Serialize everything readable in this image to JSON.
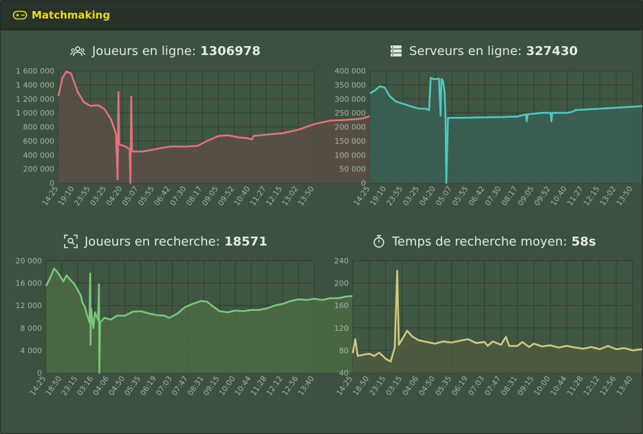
{
  "header": {
    "title": "Matchmaking",
    "icon": "gamepad-icon",
    "title_color": "#f0d81c"
  },
  "chart_data": [
    {
      "type": "area",
      "title": "Joueurs en ligne: 1306978",
      "title_label": "Joueurs en ligne:",
      "title_value": "1306978",
      "icon": "users-icon",
      "color": "#e8707e",
      "fill": "#5a4d47",
      "ylim": [
        0,
        1600000
      ],
      "yticks": [
        "0",
        "200 000",
        "400 000",
        "600 000",
        "800 000",
        "1 000 000",
        "1 200 000",
        "1 400 000",
        "1 600 000"
      ],
      "xticks": [
        "14:25",
        "19:10",
        "23:55",
        "03:25",
        "04:20",
        "05:07",
        "05:55",
        "06:42",
        "07:30",
        "08:17",
        "09:05",
        "09:52",
        "10:40",
        "11:27",
        "12:15",
        "13:02",
        "13:50"
      ],
      "grid": true,
      "points": [
        [
          0,
          1240000
        ],
        [
          0.25,
          1500000
        ],
        [
          0.5,
          1590000
        ],
        [
          0.8,
          1560000
        ],
        [
          1.2,
          1300000
        ],
        [
          1.6,
          1150000
        ],
        [
          2,
          1100000
        ],
        [
          2.5,
          1110000
        ],
        [
          2.9,
          1050000
        ],
        [
          3.3,
          900000
        ],
        [
          3.6,
          700000
        ],
        [
          3.7,
          50000
        ],
        [
          3.75,
          1300000
        ],
        [
          3.8,
          550000
        ],
        [
          4.2,
          520000
        ],
        [
          4.45,
          480000
        ],
        [
          4.5,
          0
        ],
        [
          4.55,
          1230000
        ],
        [
          4.6,
          450000
        ],
        [
          5.3,
          450000
        ],
        [
          6,
          480000
        ],
        [
          7,
          520000
        ],
        [
          8,
          520000
        ],
        [
          8.7,
          530000
        ],
        [
          9.3,
          600000
        ],
        [
          10,
          670000
        ],
        [
          10.6,
          680000
        ],
        [
          11.3,
          650000
        ],
        [
          11.8,
          640000
        ],
        [
          12.1,
          620000
        ],
        [
          12.2,
          670000
        ],
        [
          13,
          690000
        ],
        [
          14,
          710000
        ],
        [
          15,
          760000
        ],
        [
          16,
          840000
        ],
        [
          17,
          890000
        ],
        [
          18,
          900000
        ],
        [
          19,
          920000
        ],
        [
          20,
          990000
        ],
        [
          21,
          1100000
        ],
        [
          22,
          1220000
        ],
        [
          22.9,
          1300000
        ]
      ]
    },
    {
      "type": "area",
      "title": "Serveurs en ligne: 327430",
      "title_label": "Serveurs en ligne:",
      "title_value": "327430",
      "icon": "server-icon",
      "color": "#4fc9c2",
      "fill": "#395f54",
      "ylim": [
        0,
        400000
      ],
      "yticks": [
        "0",
        "50 000",
        "100 000",
        "150 000",
        "200 000",
        "250 000",
        "300 000",
        "350 000",
        "400 000"
      ],
      "xticks": [
        "14:25",
        "19:10",
        "23:55",
        "03:25",
        "04:20",
        "05:07",
        "05:55",
        "06:42",
        "07:30",
        "08:17",
        "09:05",
        "09:52",
        "10:40",
        "11:27",
        "12:15",
        "13:02",
        "13:50"
      ],
      "grid": true,
      "points": [
        [
          0,
          320000
        ],
        [
          0.3,
          330000
        ],
        [
          0.6,
          345000
        ],
        [
          0.9,
          340000
        ],
        [
          1.2,
          310000
        ],
        [
          1.6,
          290000
        ],
        [
          2,
          283000
        ],
        [
          2.4,
          275000
        ],
        [
          2.8,
          268000
        ],
        [
          3,
          265000
        ],
        [
          3.4,
          265000
        ],
        [
          3.6,
          260000
        ],
        [
          3.7,
          375000
        ],
        [
          3.9,
          370000
        ],
        [
          4.2,
          372000
        ],
        [
          4.3,
          240000
        ],
        [
          4.35,
          370000
        ],
        [
          4.45,
          365000
        ],
        [
          4.55,
          320000
        ],
        [
          4.6,
          235000
        ],
        [
          4.65,
          0
        ],
        [
          4.75,
          232000
        ],
        [
          6,
          233000
        ],
        [
          8,
          235000
        ],
        [
          9,
          237000
        ],
        [
          9.5,
          245000
        ],
        [
          9.55,
          220000
        ],
        [
          9.6,
          245000
        ],
        [
          10.5,
          250000
        ],
        [
          11,
          250000
        ],
        [
          11.05,
          220000
        ],
        [
          11.1,
          250000
        ],
        [
          12,
          250000
        ],
        [
          12.4,
          255000
        ],
        [
          12.5,
          260000
        ],
        [
          14,
          265000
        ],
        [
          16,
          272000
        ],
        [
          18,
          280000
        ],
        [
          18.3,
          290000
        ],
        [
          19,
          288000
        ],
        [
          20,
          292000
        ],
        [
          21,
          293000
        ],
        [
          21.5,
          300000
        ],
        [
          22,
          305000
        ],
        [
          22.5,
          313000
        ],
        [
          23,
          320000
        ],
        [
          23.9,
          327000
        ]
      ]
    },
    {
      "type": "area",
      "title": "Joueurs en recherche: 18571",
      "title_label": "Joueurs en recherche:",
      "title_value": "18571",
      "icon": "user-search-icon",
      "color": "#78c878",
      "fill": "#4b6a44",
      "ylim": [
        0,
        20000
      ],
      "yticks": [
        "0",
        "4 000",
        "8 000",
        "12 000",
        "16 000",
        "20 000"
      ],
      "xticks": [
        "14:25",
        "18:50",
        "23:15",
        "03:16",
        "04:06",
        "04:50",
        "05:35",
        "06:19",
        "07:03",
        "07:47",
        "08:31",
        "09:15",
        "10:00",
        "10:44",
        "11:28",
        "12:12",
        "12:56",
        "13:40"
      ],
      "grid": true,
      "points": [
        [
          0,
          15500
        ],
        [
          0.3,
          17200
        ],
        [
          0.5,
          18600
        ],
        [
          0.7,
          18000
        ],
        [
          0.9,
          17200
        ],
        [
          1.1,
          16300
        ],
        [
          1.3,
          17400
        ],
        [
          1.5,
          16700
        ],
        [
          1.8,
          15800
        ],
        [
          2,
          14800
        ],
        [
          2.2,
          13800
        ],
        [
          2.3,
          12500
        ],
        [
          2.45,
          11800
        ],
        [
          2.6,
          10300
        ],
        [
          2.75,
          9000
        ],
        [
          2.8,
          17700
        ],
        [
          2.82,
          5000
        ],
        [
          2.85,
          11500
        ],
        [
          3,
          8000
        ],
        [
          3.1,
          10800
        ],
        [
          3.3,
          9400
        ],
        [
          3.35,
          15800
        ],
        [
          3.38,
          0
        ],
        [
          3.42,
          9000
        ],
        [
          3.7,
          9800
        ],
        [
          4.1,
          9500
        ],
        [
          4.5,
          10200
        ],
        [
          5,
          10200
        ],
        [
          5.5,
          10900
        ],
        [
          6,
          11000
        ],
        [
          6.5,
          10600
        ],
        [
          7,
          10300
        ],
        [
          7.5,
          10200
        ],
        [
          7.8,
          9800
        ],
        [
          8.3,
          10500
        ],
        [
          8.8,
          11700
        ],
        [
          9.3,
          12300
        ],
        [
          9.8,
          12800
        ],
        [
          10.2,
          12700
        ],
        [
          10.5,
          12000
        ],
        [
          11,
          11000
        ],
        [
          11.5,
          10800
        ],
        [
          12,
          11100
        ],
        [
          12.5,
          11000
        ],
        [
          13,
          11200
        ],
        [
          13.5,
          11200
        ],
        [
          14,
          11500
        ],
        [
          14.5,
          12000
        ],
        [
          15,
          12300
        ],
        [
          15.5,
          12800
        ],
        [
          16,
          13100
        ],
        [
          16.5,
          13000
        ],
        [
          17,
          13200
        ],
        [
          17.5,
          13000
        ],
        [
          18,
          13300
        ],
        [
          18.5,
          13300
        ],
        [
          19,
          13600
        ],
        [
          19.5,
          13700
        ],
        [
          20,
          14300
        ],
        [
          20.5,
          14500
        ],
        [
          21,
          14900
        ],
        [
          21.5,
          15600
        ],
        [
          22,
          16200
        ],
        [
          22.5,
          16900
        ],
        [
          23,
          17800
        ],
        [
          23.5,
          18300
        ],
        [
          24,
          18600
        ]
      ]
    },
    {
      "type": "area",
      "title": "Temps de recherche moyen: 58s",
      "title_label": "Temps de recherche moyen:",
      "title_value": "58s",
      "icon": "stopwatch-icon",
      "color": "#d2c97a",
      "fill": "#4d5a3f",
      "ylim": [
        40,
        240
      ],
      "yticks": [
        "40",
        "80",
        "120",
        "160",
        "200",
        "240"
      ],
      "xticks": [
        "14:25",
        "18:50",
        "23:15",
        "03:15",
        "04:06",
        "04:50",
        "05:35",
        "06:19",
        "07:03",
        "07:47",
        "08:31",
        "09:15",
        "10:00",
        "10:44",
        "11:28",
        "12:12",
        "12:56",
        "13:40"
      ],
      "grid": true,
      "points": [
        [
          0,
          75
        ],
        [
          0.15,
          100
        ],
        [
          0.3,
          70
        ],
        [
          0.6,
          72
        ],
        [
          1,
          74
        ],
        [
          1.3,
          70
        ],
        [
          1.6,
          76
        ],
        [
          2,
          65
        ],
        [
          2.3,
          60
        ],
        [
          2.55,
          85
        ],
        [
          2.7,
          222
        ],
        [
          2.8,
          90
        ],
        [
          3,
          100
        ],
        [
          3.3,
          115
        ],
        [
          3.6,
          105
        ],
        [
          4,
          98
        ],
        [
          4.5,
          95
        ],
        [
          5,
          92
        ],
        [
          5.5,
          96
        ],
        [
          6,
          94
        ],
        [
          6.5,
          97
        ],
        [
          7,
          100
        ],
        [
          7.5,
          93
        ],
        [
          8,
          95
        ],
        [
          8.2,
          88
        ],
        [
          8.5,
          96
        ],
        [
          9,
          90
        ],
        [
          9.3,
          104
        ],
        [
          9.5,
          88
        ],
        [
          10,
          88
        ],
        [
          10.3,
          95
        ],
        [
          10.7,
          86
        ],
        [
          11,
          92
        ],
        [
          11.5,
          87
        ],
        [
          12,
          89
        ],
        [
          12.5,
          85
        ],
        [
          13,
          88
        ],
        [
          13.5,
          85
        ],
        [
          14,
          83
        ],
        [
          14.5,
          86
        ],
        [
          15,
          82
        ],
        [
          15.5,
          88
        ],
        [
          16,
          82
        ],
        [
          16.5,
          84
        ],
        [
          17,
          80
        ],
        [
          17.5,
          82
        ],
        [
          18,
          78
        ],
        [
          18.5,
          82
        ],
        [
          19,
          78
        ],
        [
          19.5,
          80
        ],
        [
          20,
          76
        ],
        [
          20.5,
          74
        ],
        [
          21,
          76
        ],
        [
          21.5,
          73
        ],
        [
          22,
          72
        ],
        [
          22.5,
          74
        ],
        [
          23,
          70
        ],
        [
          23.5,
          68
        ],
        [
          24,
          63
        ]
      ]
    }
  ]
}
